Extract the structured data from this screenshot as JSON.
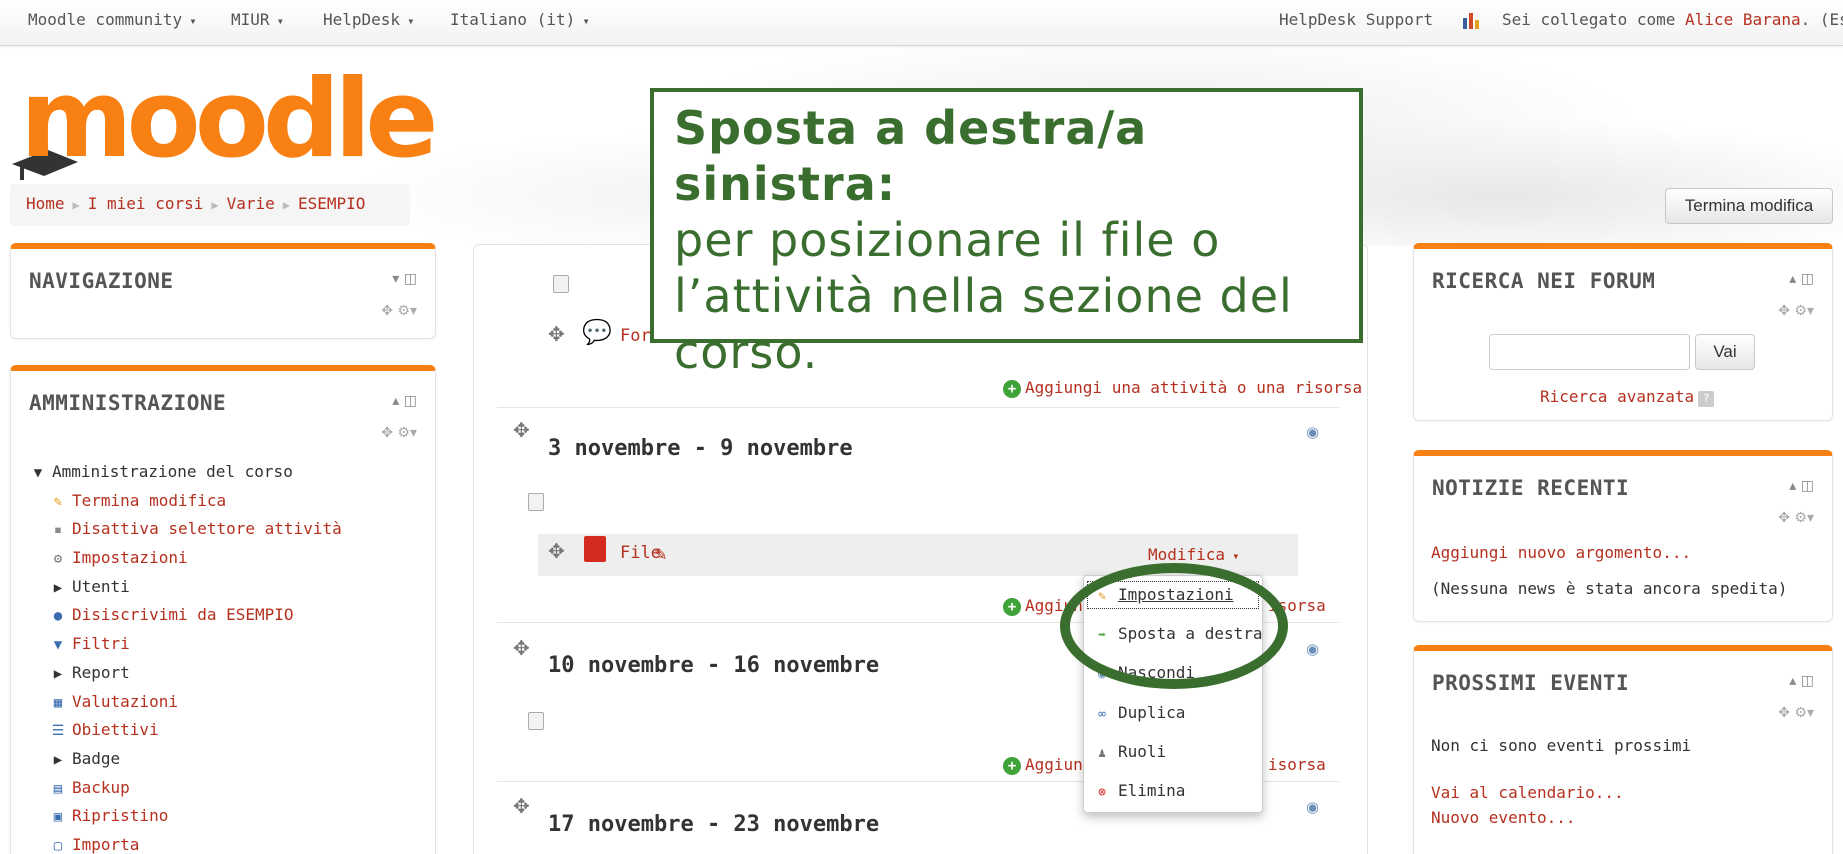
{
  "navbar": {
    "items": [
      "Moodle community",
      "MIUR",
      "HelpDesk",
      "Italiano (it)"
    ],
    "support": "HelpDesk Support",
    "logged_prefix": "Sei collegato come",
    "user": "Alice Barana",
    "logout": "(Esci)"
  },
  "logo": "moodle",
  "breadcrumb": [
    "Home",
    "I miei corsi",
    "Varie",
    "ESEMPIO"
  ],
  "edit_button": "Termina modifica",
  "callout": {
    "bold": "Sposta a destra/a sinistra:",
    "text": "per posizionare il file o l’attività nella sezione del corso."
  },
  "left": {
    "navigation_title": "NAVIGAZIONE",
    "admin_title": "AMMINISTRAZIONE",
    "admin_items": [
      {
        "label": "Amministrazione del corso",
        "icon": "triangle-down-icon",
        "link": false
      },
      {
        "label": "Termina modifica",
        "icon": "pencil-icon",
        "link": true
      },
      {
        "label": "Disattiva selettore attività",
        "icon": "bullet-icon",
        "link": true
      },
      {
        "label": "Impostazioni",
        "icon": "settings-icon",
        "link": true
      },
      {
        "label": "Utenti",
        "icon": "triangle-right-icon",
        "link": false
      },
      {
        "label": "Disiscrivimi da ESEMPIO",
        "icon": "user-icon",
        "link": true
      },
      {
        "label": "Filtri",
        "icon": "filter-icon",
        "link": true
      },
      {
        "label": "Report",
        "icon": "triangle-right-icon",
        "link": false
      },
      {
        "label": "Valutazioni",
        "icon": "grades-icon",
        "link": true
      },
      {
        "label": "Obiettivi",
        "icon": "outcomes-icon",
        "link": true
      },
      {
        "label": "Badge",
        "icon": "triangle-right-icon",
        "link": false
      },
      {
        "label": "Backup",
        "icon": "backup-icon",
        "link": true
      },
      {
        "label": "Ripristino",
        "icon": "restore-icon",
        "link": true
      },
      {
        "label": "Importa",
        "icon": "import-icon",
        "link": true
      }
    ]
  },
  "course": {
    "forum_label": "For",
    "add_activity": "Aggiungi una attività o una risorsa",
    "add_partial": "Aggiungi",
    "add_tail": "isorsa",
    "sections": [
      {
        "title": "3 novembre - 9 novembre"
      },
      {
        "title": "10 novembre - 16 novembre"
      },
      {
        "title": "17 novembre - 23 novembre"
      }
    ],
    "file_label": "File",
    "modifica": "Modifica"
  },
  "menu": [
    {
      "label": "Impostazioni",
      "icon": "pencil-icon"
    },
    {
      "label": "Sposta a destra",
      "icon": "arrow-right-icon"
    },
    {
      "label": "Nascondi",
      "icon": "eye-icon"
    },
    {
      "label": "Duplica",
      "icon": "duplicate-icon"
    },
    {
      "label": "Ruoli",
      "icon": "roles-icon"
    },
    {
      "label": "Elimina",
      "icon": "delete-icon"
    }
  ],
  "right": {
    "forum_title": "RICERCA NEI FORUM",
    "search_button": "Vai",
    "advanced_search": "Ricerca avanzata",
    "news_title": "NOTIZIE RECENTI",
    "add_topic": "Aggiungi nuovo argomento...",
    "no_news": "(Nessuna news è stata ancora spedita)",
    "events_title": "PROSSIMI EVENTI",
    "no_events": "Non ci sono eventi prossimi",
    "calendar": "Vai al calendario...",
    "new_event": "Nuovo evento..."
  },
  "colors": {
    "accent": "#f98012",
    "link": "#b5301f",
    "callout": "#3a6e2f"
  }
}
